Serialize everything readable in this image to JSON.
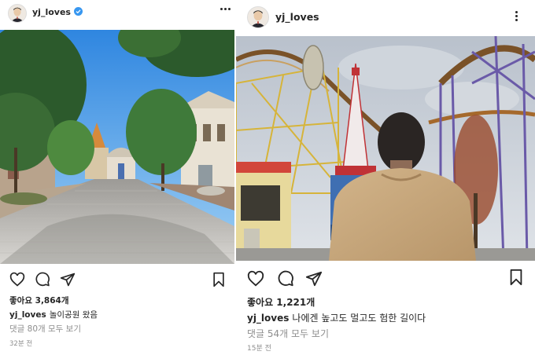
{
  "post1": {
    "username": "yj_loves",
    "likes_text": "좋아요 3,864개",
    "caption_user": "yj_loves",
    "caption": "놀이공원 왔음",
    "comments_link": "댓글 80개 모두 보기",
    "time": "32분 전",
    "icons": [
      "more-icon",
      "heart-icon",
      "comment-icon",
      "share-icon",
      "bookmark-icon",
      "verified-badge-icon"
    ]
  },
  "post2": {
    "username": "yj_loves",
    "likes_text": "좋아요 1,221개",
    "caption_user": "yj_loves",
    "caption": "나에겐 높고도 멀고도 험한 길이다",
    "comments_link": "댓글 54개 모두 보기",
    "time": "15분 전",
    "icons": [
      "more-icon",
      "heart-icon",
      "comment-icon",
      "share-icon",
      "bookmark-icon"
    ]
  },
  "colors": {
    "text": "#262626",
    "muted": "#8e8e8e",
    "verified": "#3897f0"
  }
}
